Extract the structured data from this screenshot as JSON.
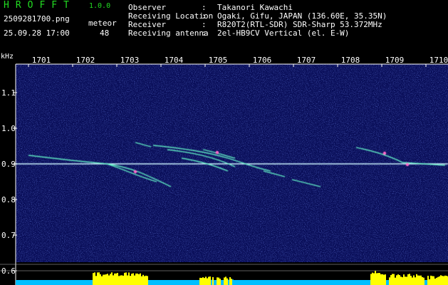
{
  "header": {
    "app_title": "HROFFT",
    "app_version": "1.0.0",
    "filename": "2509281700.png",
    "datetime": "25.09.28 17:00",
    "meteor_label": "meteor",
    "meteor_count": "48",
    "info": [
      {
        "key": "Observer",
        "sep": ":",
        "value": "Takanori Kawachi"
      },
      {
        "key": "Receiving Location",
        "sep": ":",
        "value": "Ogaki, Gifu, JAPAN (136.60E, 35.35N)"
      },
      {
        "key": "Receiver",
        "sep": ":",
        "value": "R820T2(RTL-SDR) SDR-Sharp 53.372MHz"
      },
      {
        "key": "Receiving antenna",
        "sep": ":",
        "value": "2el-HB9CV Vertical (el. E-W)"
      }
    ]
  },
  "spectrogram": {
    "unit_label": "kHz",
    "time_ticks": [
      "1701",
      "1702",
      "1703",
      "1704",
      "1705",
      "1706",
      "1707",
      "1708",
      "1709",
      "1710"
    ],
    "freq_ticks": [
      "1.1",
      "1.0",
      "0.9",
      "0.8",
      "0.7",
      "0.6"
    ],
    "colors": {
      "background": "#0a0f5a",
      "echo": "#66ffcc",
      "carrier": "#ccf4ff",
      "level": "#ffff00",
      "level_base": "#00bfff",
      "axis": "#ffffff"
    }
  }
}
